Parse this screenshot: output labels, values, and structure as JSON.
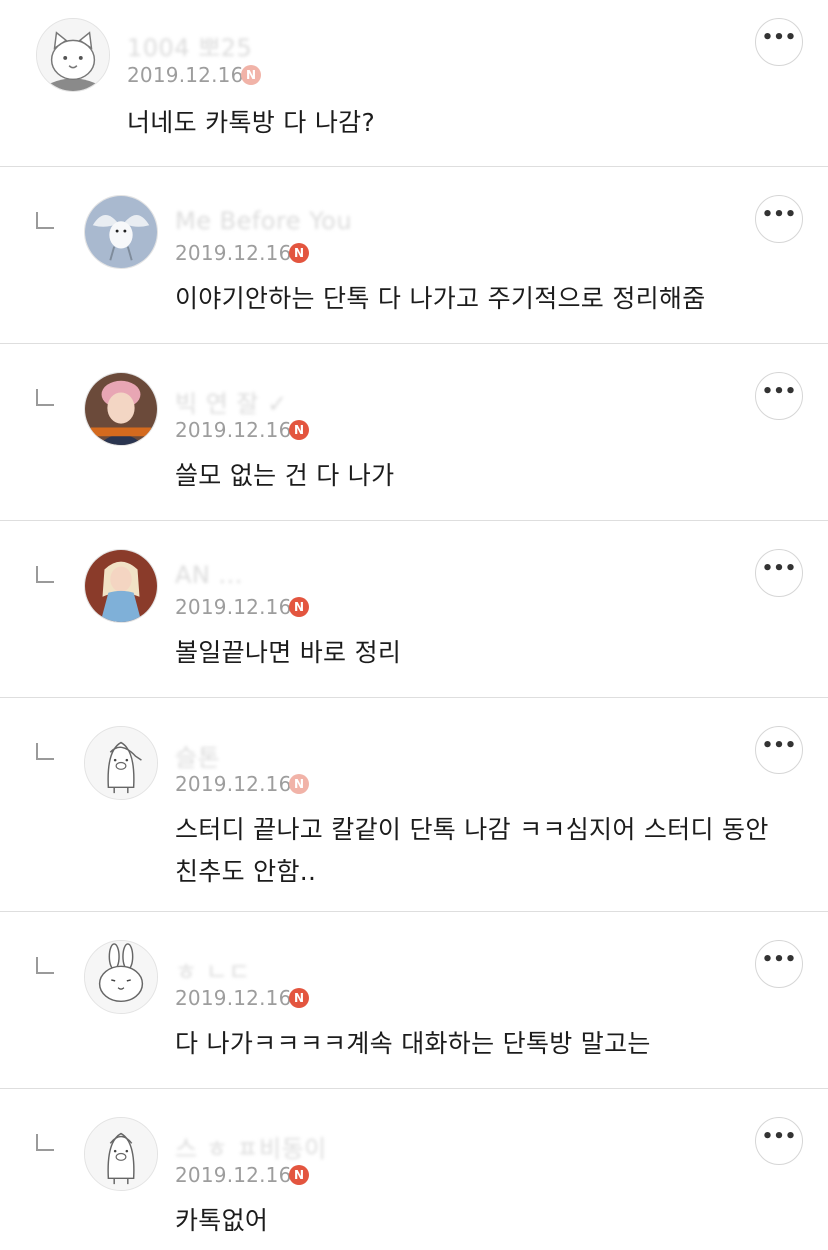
{
  "more_label": "•••",
  "comments": [
    {
      "nickname": "1004 뽀25",
      "date": "2019.12.16",
      "badge": "N",
      "text_lines": [
        "너네도 카톡방 다 나감?"
      ]
    },
    {
      "nickname": "Me Before You",
      "date": "2019.12.16",
      "badge": "N",
      "text_lines": [
        "이야기안하는 단톡 다 나가고 주기적으로 정리해줌"
      ]
    },
    {
      "nickname": "빅 연 잘 ✓",
      "date": "2019.12.16",
      "badge": "N",
      "text_lines": [
        "쓸모 없는 건 다 나가"
      ]
    },
    {
      "nickname": "AN ...",
      "date": "2019.12.16",
      "badge": "N",
      "text_lines": [
        "볼일끝나면 바로 정리"
      ]
    },
    {
      "nickname": "슬톤",
      "date": "2019.12.16",
      "badge": "N",
      "text_lines": [
        "스터디 끝나고 칼같이 단톡 나감 ㅋㅋ심지어 스터디 동안",
        "친추도 안함.."
      ]
    },
    {
      "nickname": "ㅎ ㄴㄷ",
      "date": "2019.12.16",
      "badge": "N",
      "text_lines": [
        "다 나가ㅋㅋㅋㅋ계속 대화하는 단톡방 말고는"
      ]
    },
    {
      "nickname": "스 ㅎ ㅍ비동이",
      "date": "2019.12.16",
      "badge": "N",
      "text_lines": [
        "카톡없어"
      ]
    }
  ]
}
